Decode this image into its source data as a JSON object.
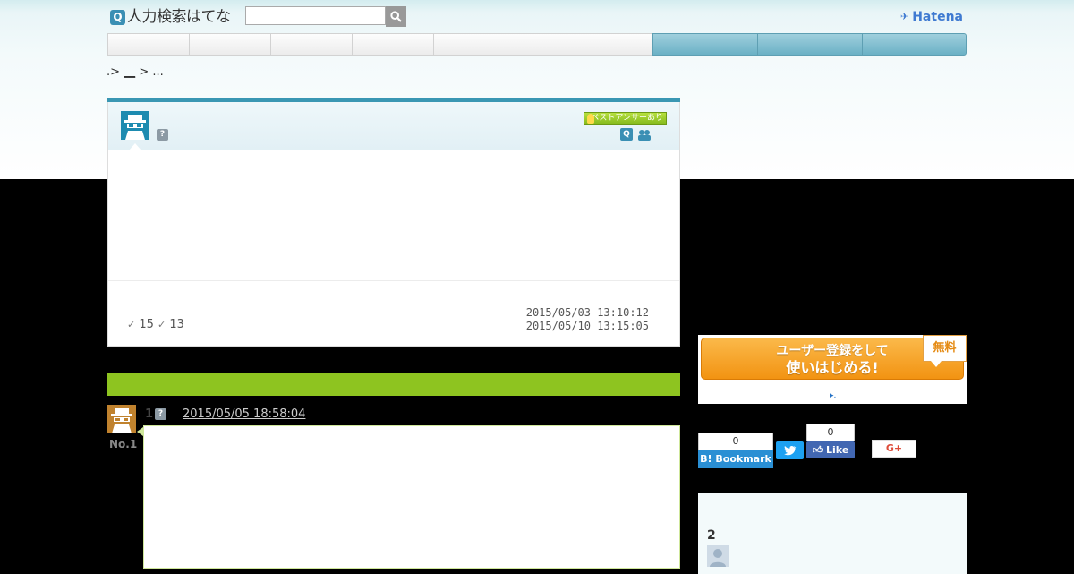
{
  "header": {
    "logo_mark": "Q",
    "logo_text": "人力検索はてな",
    "search_placeholder": "",
    "hatena_label": "Hatena",
    "hatena_mark": "✈"
  },
  "nav": {
    "items": [
      "",
      "",
      "",
      "",
      "",
      "",
      "",
      ""
    ]
  },
  "breadcrumb": {
    "prefix": ".>",
    "link": "__",
    "separator": ">",
    "tail": "..."
  },
  "question": {
    "help_mark": "?",
    "best_answer_badge": "ベストアンサーあり",
    "small_q_mark": "Q",
    "stats": {
      "count_a": "15",
      "count_b": "13",
      "check": "✓"
    },
    "dates": {
      "posted": "2015/05/03 13:10:12",
      "closed": "2015/05/10 13:15:05"
    }
  },
  "answer": {
    "index": "1",
    "help_mark": "?",
    "number_label": "No.1",
    "date": "2015/05/05 18:58:04"
  },
  "sidebar": {
    "register_line1": "ユーザー登録をして",
    "register_line2": "使いはじめる!",
    "register_free": "無料",
    "register_link": "▸.",
    "bookmark_count": "0",
    "bookmark_label": "B! Bookmark",
    "twitter_label": "🐦",
    "facebook_count": "0",
    "facebook_label": "Like",
    "gplus_label": "G+",
    "panel_count": "2"
  },
  "colors": {
    "nav_blue": "#6bb1c6",
    "accent_blue": "#3a97b3",
    "answer_green": "#8ec420",
    "register_orange": "#f29312"
  }
}
